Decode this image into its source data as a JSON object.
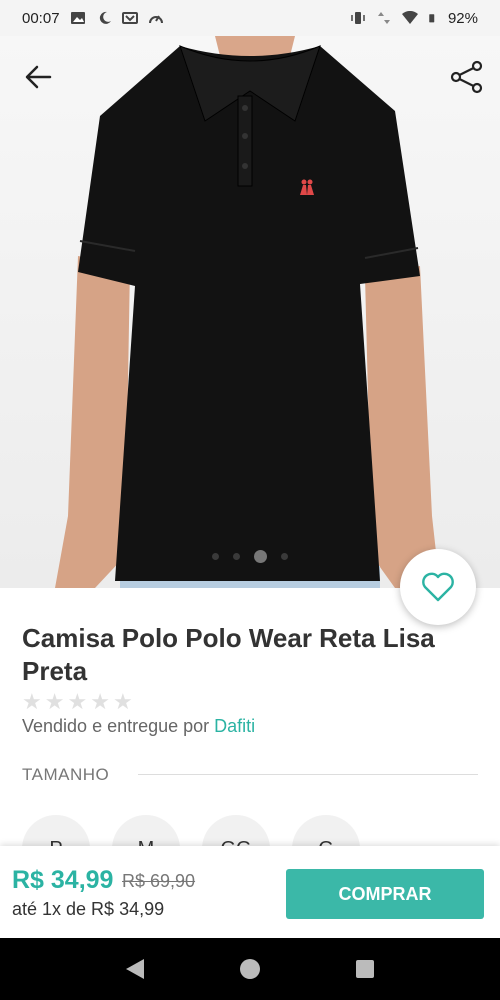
{
  "status": {
    "time": "00:07",
    "battery": "92%",
    "left_icons": [
      "image-icon",
      "moon-icon",
      "notification-icon",
      "speedometer-icon"
    ],
    "right_icons": [
      "vibrate-icon",
      "data-arrows-icon",
      "wifi-icon",
      "battery-icon"
    ]
  },
  "product": {
    "title": "Camisa Polo Polo Wear Reta Lisa Preta",
    "rating_stars": 5,
    "seller_prefix": "Vendido e entregue por",
    "seller_name": "Dafiti",
    "carousel": {
      "count": 4,
      "active_index": 2
    }
  },
  "size": {
    "label": "TAMANHO",
    "options": [
      "P",
      "M",
      "GG",
      "G"
    ]
  },
  "purchase": {
    "price": "R$ 34,99",
    "old_price": "R$ 69,90",
    "installments": "até 1x de R$ 34,99",
    "buy_label": "COMPRAR"
  },
  "colors": {
    "accent": "#2bb3a3",
    "shirt": "#121212",
    "logo": "#e04848"
  }
}
